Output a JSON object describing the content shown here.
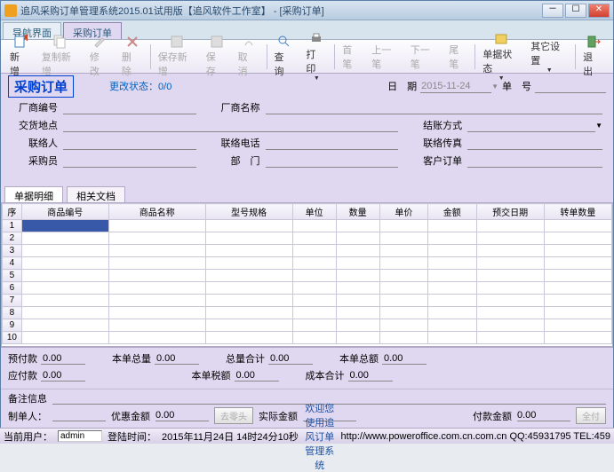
{
  "window": {
    "title": "追风采购订单管理系统2015.01试用版【追风软件工作室】 - [采购订单]"
  },
  "maintabs": [
    {
      "label": "导航界面"
    },
    {
      "label": "采购订单",
      "active": true
    }
  ],
  "toolbar": {
    "new": "新 增",
    "copy": "复制新增",
    "edit": "修 改",
    "del": "删 除",
    "savenew": "保存新增",
    "save": "保 存",
    "cancel": "取 消",
    "query": "查 询",
    "print": "打 印",
    "first": "首笔",
    "prev": "上一笔",
    "next": "下一笔",
    "last": "尾笔",
    "state": "单据状态",
    "other": "其它设置",
    "exit": "退 出"
  },
  "order": {
    "title": "采购订单",
    "changeStatus": "更改状态：",
    "changeVal": "0/0",
    "dateLbl": "日　期",
    "date": "2015-11-24",
    "noLbl": "单　号",
    "no": "",
    "fields": {
      "vendorNoLbl": "厂商编号",
      "vendorNo": "",
      "vendorNameLbl": "厂商名称",
      "vendorName": "",
      "addrLbl": "交货地点",
      "addr": "",
      "payMethodLbl": "结账方式",
      "payMethod": "",
      "contactLbl": "联络人",
      "contact": "",
      "telLbl": "联络电话",
      "tel": "",
      "faxLbl": "联络传真",
      "fax": "",
      "buyerLbl": "采购员",
      "buyer": "",
      "deptLbl": "部　门",
      "dept": "",
      "custOrdLbl": "客户订单",
      "custOrd": ""
    }
  },
  "dettabs": [
    {
      "label": "单据明细",
      "active": true
    },
    {
      "label": "相关文档"
    }
  ],
  "gridCols": [
    "序",
    "商品编号",
    "商品名称",
    "型号规格",
    "单位",
    "数量",
    "单价",
    "金额",
    "预交日期",
    "转单数量"
  ],
  "gridRows": 10,
  "totals": {
    "prepayLbl": "预付款",
    "prepay": "0.00",
    "thisQtyLbl": "本单总量",
    "thisQty": "0.00",
    "totQtyLbl": "总量合计",
    "totQty": "0.00",
    "thisAmtLbl": "本单总额",
    "thisAmt": "0.00",
    "payableLbl": "应付款",
    "payable": "0.00",
    "taxLbl": "本单税额",
    "tax": "0.00",
    "costLbl": "成本合计",
    "cost": "0.00"
  },
  "remark": {
    "noteLbl": "备注信息",
    "makerLbl": "制单人：",
    "maker": "",
    "discLbl": "优惠金额",
    "disc": "0.00",
    "delHeadLbl": "去零头",
    "realLbl": "实际金额",
    "real": "",
    "payAmtLbl": "付款金额",
    "payAmt": "0.00",
    "payAllLbl": "全付"
  },
  "status": {
    "userLbl": "当前用户：",
    "user": "admin",
    "loginLbl": "登陆时间：",
    "login": "2015年11月24日 14时24分10秒",
    "welcome": "欢迎您使用追风订单管理系统",
    "url": "http://www.poweroffice.com.cn.com.cn QQ:45931795 TEL:459"
  }
}
